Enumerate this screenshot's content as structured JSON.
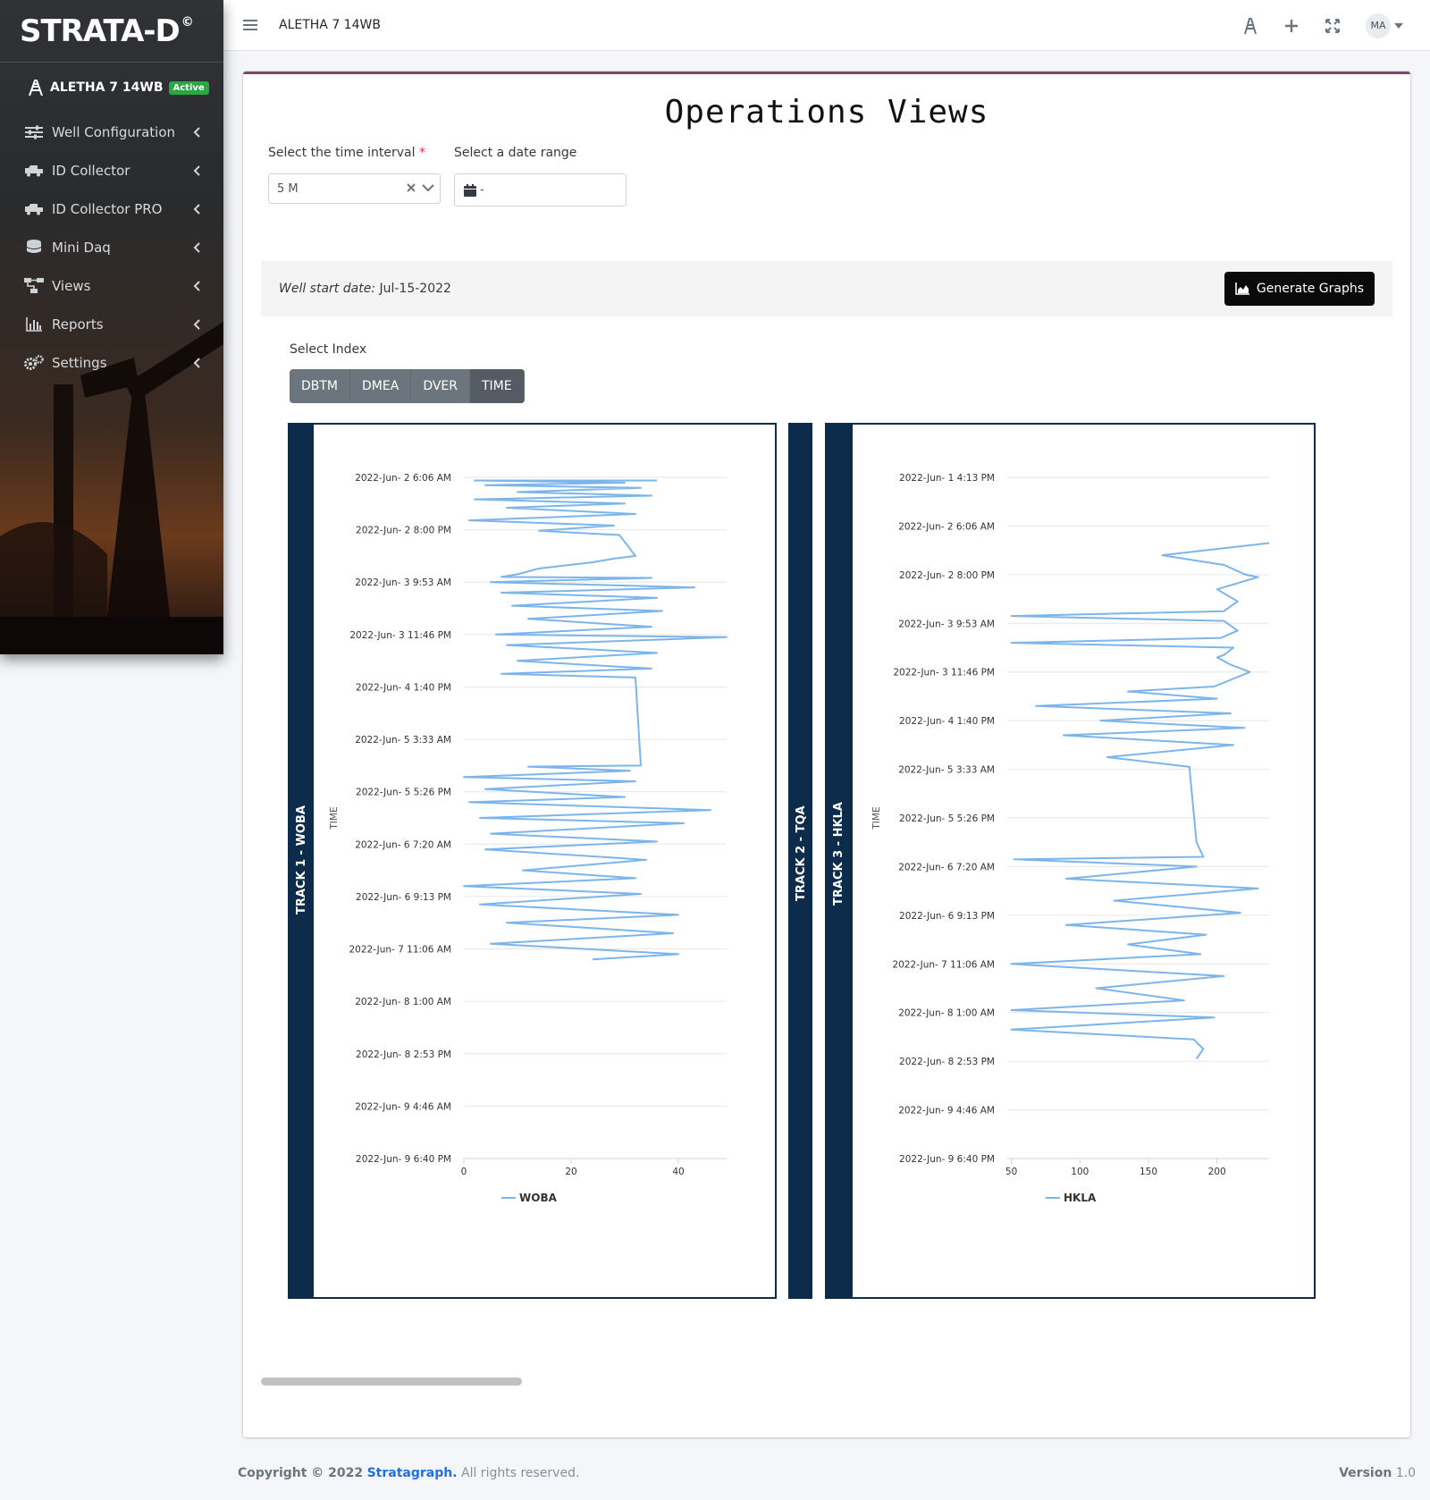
{
  "brand": {
    "name": "STRATA-D",
    "mark": "©"
  },
  "sidebar": {
    "well_name": "ALETHA 7 14WB",
    "well_status": "Active",
    "items": [
      {
        "label": "Well Configuration",
        "icon": "sliders-icon"
      },
      {
        "label": "ID Collector",
        "icon": "truck-icon"
      },
      {
        "label": "ID Collector PRO",
        "icon": "truck-icon"
      },
      {
        "label": "Mini Daq",
        "icon": "database-icon"
      },
      {
        "label": "Views",
        "icon": "sitemap-icon"
      },
      {
        "label": "Reports",
        "icon": "bar-chart-icon"
      },
      {
        "label": "Settings",
        "icon": "gears-icon"
      }
    ]
  },
  "topbar": {
    "title": "ALETHA 7 14WB",
    "user_initials": "MA"
  },
  "page": {
    "title": "Operations Views",
    "interval_label": "Select the time interval",
    "interval_required_mark": "*",
    "interval_value": "5 M",
    "date_label": "Select a date range",
    "date_value": "-",
    "well_start_label": "Well start date:",
    "well_start_value": "Jul-15-2022",
    "generate_button": "Generate Graphs",
    "index_label": "Select Index",
    "index_buttons": [
      "DBTM",
      "DMEA",
      "DVER",
      "TIME"
    ],
    "index_selected": "TIME"
  },
  "tracks": [
    {
      "label": "TRACK 1 - WOBA"
    },
    {
      "label": "TRACK 2 - TQA"
    },
    {
      "label": "TRACK 3 - HKLA"
    }
  ],
  "colors": {
    "series": "#7cb5ec",
    "track": "#0d2b4a",
    "accent": "#7b4a63",
    "active": "#28a745"
  },
  "chart_data": [
    {
      "type": "line",
      "orientation": "vertical-time",
      "ylabel": "TIME",
      "y_ticks": [
        "2022-Jun- 2 6:06 AM",
        "2022-Jun- 2 8:00 PM",
        "2022-Jun- 3 9:53 AM",
        "2022-Jun- 3 11:46 PM",
        "2022-Jun- 4 1:40 PM",
        "2022-Jun- 5 3:33 AM",
        "2022-Jun- 5 5:26 PM",
        "2022-Jun- 6 7:20 AM",
        "2022-Jun- 6 9:13 PM",
        "2022-Jun- 7 11:06 AM",
        "2022-Jun- 8 1:00 AM",
        "2022-Jun- 8 2:53 PM",
        "2022-Jun- 9 4:46 AM",
        "2022-Jun- 9 6:40 PM"
      ],
      "x_ticks": [
        0,
        20,
        40
      ],
      "xlim": [
        0,
        49
      ],
      "series": [
        {
          "name": "WOBA",
          "points": [
            [
              0.06,
              36
            ],
            [
              0.06,
              2
            ],
            [
              0.1,
              30
            ],
            [
              0.15,
              4
            ],
            [
              0.2,
              33
            ],
            [
              0.28,
              10
            ],
            [
              0.35,
              35
            ],
            [
              0.42,
              2
            ],
            [
              0.5,
              30
            ],
            [
              0.58,
              8
            ],
            [
              0.7,
              32
            ],
            [
              0.82,
              1
            ],
            [
              0.92,
              28
            ],
            [
              1.02,
              14
            ],
            [
              1.1,
              29
            ],
            [
              1.5,
              32
            ],
            [
              1.55,
              28
            ],
            [
              1.62,
              24
            ],
            [
              1.74,
              14
            ],
            [
              1.85,
              10
            ],
            [
              1.9,
              7
            ],
            [
              1.92,
              35
            ],
            [
              2.0,
              5
            ],
            [
              2.1,
              43
            ],
            [
              2.2,
              7
            ],
            [
              2.3,
              36
            ],
            [
              2.45,
              9
            ],
            [
              2.55,
              37
            ],
            [
              2.7,
              12
            ],
            [
              2.85,
              35
            ],
            [
              3.0,
              6
            ],
            [
              3.05,
              49
            ],
            [
              3.2,
              8
            ],
            [
              3.35,
              36
            ],
            [
              3.5,
              10
            ],
            [
              3.65,
              35
            ],
            [
              3.75,
              7
            ],
            [
              3.82,
              32
            ],
            [
              5.5,
              33
            ],
            [
              5.52,
              12
            ],
            [
              5.6,
              31
            ],
            [
              5.72,
              0
            ],
            [
              5.8,
              32
            ],
            [
              5.95,
              4
            ],
            [
              6.1,
              30
            ],
            [
              6.2,
              1
            ],
            [
              6.35,
              46
            ],
            [
              6.5,
              3
            ],
            [
              6.6,
              41
            ],
            [
              6.8,
              5
            ],
            [
              6.95,
              36
            ],
            [
              7.1,
              4
            ],
            [
              7.3,
              34
            ],
            [
              7.5,
              11
            ],
            [
              7.65,
              32
            ],
            [
              7.8,
              0
            ],
            [
              7.95,
              33
            ],
            [
              8.15,
              3
            ],
            [
              8.35,
              40
            ],
            [
              8.5,
              8
            ],
            [
              8.7,
              39
            ],
            [
              8.9,
              5
            ],
            [
              9.1,
              40
            ],
            [
              9.2,
              24
            ]
          ]
        }
      ]
    },
    {
      "type": "line",
      "orientation": "vertical-time",
      "ylabel": "TIME",
      "y_ticks": [
        "2022-Jun- 1 4:13 PM",
        "2022-Jun- 2 6:06 AM",
        "2022-Jun- 2 8:00 PM",
        "2022-Jun- 3 9:53 AM",
        "2022-Jun- 3 11:46 PM",
        "2022-Jun- 4 1:40 PM",
        "2022-Jun- 5 3:33 AM",
        "2022-Jun- 5 5:26 PM",
        "2022-Jun- 6 7:20 AM",
        "2022-Jun- 6 9:13 PM",
        "2022-Jun- 7 11:06 AM",
        "2022-Jun- 8 1:00 AM",
        "2022-Jun- 8 2:53 PM",
        "2022-Jun- 9 4:46 AM",
        "2022-Jun- 9 6:40 PM"
      ],
      "x_ticks": [
        50,
        100,
        150,
        200
      ],
      "xlim": [
        47,
        238
      ],
      "series": [
        {
          "name": "HKLA",
          "points": [
            [
              1.35,
              244
            ],
            [
              1.6,
              160
            ],
            [
              1.8,
              205
            ],
            [
              2.0,
              221
            ],
            [
              2.05,
              230
            ],
            [
              2.3,
              200
            ],
            [
              2.55,
              215
            ],
            [
              2.75,
              205
            ],
            [
              2.85,
              50
            ],
            [
              2.95,
              205
            ],
            [
              3.15,
              215
            ],
            [
              3.3,
              203
            ],
            [
              3.4,
              50
            ],
            [
              3.5,
              212
            ],
            [
              3.65,
              205
            ],
            [
              3.7,
              200
            ],
            [
              3.85,
              210
            ],
            [
              4.0,
              224
            ],
            [
              4.3,
              198
            ],
            [
              4.4,
              135
            ],
            [
              4.55,
              200
            ],
            [
              4.7,
              68
            ],
            [
              4.85,
              210
            ],
            [
              5.0,
              115
            ],
            [
              5.15,
              220
            ],
            [
              5.3,
              88
            ],
            [
              5.5,
              212
            ],
            [
              5.75,
              120
            ],
            [
              5.95,
              180
            ],
            [
              6.0,
              180
            ],
            [
              7.5,
              185
            ],
            [
              7.8,
              190
            ],
            [
              7.85,
              52
            ],
            [
              8.0,
              185
            ],
            [
              8.25,
              90
            ],
            [
              8.45,
              230
            ],
            [
              8.7,
              125
            ],
            [
              8.95,
              217
            ],
            [
              9.2,
              90
            ],
            [
              9.4,
              192
            ],
            [
              9.6,
              135
            ],
            [
              9.8,
              188
            ],
            [
              10.0,
              50
            ],
            [
              10.25,
              205
            ],
            [
              10.5,
              112
            ],
            [
              10.75,
              176
            ],
            [
              10.95,
              50
            ],
            [
              11.1,
              198
            ],
            [
              11.35,
              50
            ],
            [
              11.55,
              183
            ],
            [
              11.75,
              190
            ],
            [
              11.95,
              185
            ]
          ]
        }
      ]
    }
  ],
  "footer": {
    "copyright": "Copyright © 2022",
    "company": "Stratagraph.",
    "rights": "All rights reserved.",
    "version_label": "Version",
    "version_value": "1.0"
  }
}
